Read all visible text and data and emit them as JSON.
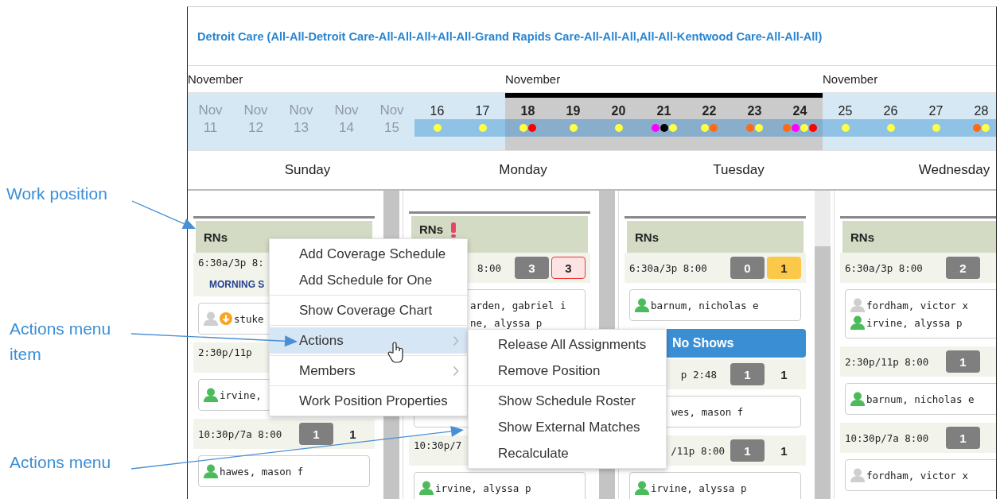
{
  "annotations": [
    {
      "text": "Work position"
    },
    {
      "text": "Actions menu item"
    },
    {
      "text": "Actions menu"
    }
  ],
  "title": "Detroit Care (All-All-Detroit Care-All-All-All+All-All-Grand Rapids Care-All-All-All,All-All-Kentwood Care-All-All-All)",
  "weeks": [
    {
      "month": "November",
      "selected": false,
      "dates": [
        {
          "label": "Nov",
          "day": "11",
          "dimmed": true
        },
        {
          "label": "Nov",
          "day": "12",
          "dimmed": true
        },
        {
          "label": "Nov",
          "day": "13",
          "dimmed": true
        },
        {
          "label": "Nov",
          "day": "14",
          "dimmed": true
        },
        {
          "label": "Nov",
          "day": "15",
          "dimmed": true
        },
        {
          "day": "16",
          "dimmed": false,
          "dots": [
            {
              "color": "#ffff44"
            }
          ]
        },
        {
          "day": "17",
          "dimmed": false,
          "dots": [
            {
              "color": "#ffff44"
            }
          ]
        }
      ]
    },
    {
      "month": "November",
      "selected": true,
      "dates": [
        {
          "day": "18",
          "dimmed": false,
          "dots": [
            {
              "color": "#ffff44"
            },
            {
              "color": "#ff0000"
            }
          ]
        },
        {
          "day": "19",
          "dimmed": false,
          "dots": [
            {
              "color": "#ffff44"
            }
          ]
        },
        {
          "day": "20",
          "dimmed": false,
          "dots": [
            {
              "color": "#ffff44"
            }
          ]
        },
        {
          "day": "21",
          "dimmed": false,
          "dots": [
            {
              "color": "#ff00ff"
            },
            {
              "color": "#000000"
            },
            {
              "color": "#ffff44"
            }
          ]
        },
        {
          "day": "22",
          "dimmed": false,
          "dots": [
            {
              "color": "#ffff44"
            },
            {
              "color": "#ff6a13"
            }
          ]
        },
        {
          "day": "23",
          "dimmed": false,
          "dots": [
            {
              "color": "#ff6a13"
            },
            {
              "color": "#ffff44"
            }
          ]
        },
        {
          "day": "24",
          "dimmed": false,
          "dots": [
            {
              "color": "#ff6a13"
            },
            {
              "color": "#ff00ff"
            },
            {
              "color": "#ffff44"
            },
            {
              "color": "#ff0000"
            }
          ]
        }
      ]
    },
    {
      "month": "November",
      "selected": false,
      "dates": [
        {
          "day": "25",
          "dimmed": false,
          "dots": [
            {
              "color": "#ffff44"
            }
          ]
        },
        {
          "day": "26",
          "dimmed": false,
          "dots": [
            {
              "color": "#ffff44"
            }
          ]
        },
        {
          "day": "27",
          "dimmed": false,
          "dots": [
            {
              "color": "#ffff44"
            }
          ]
        },
        {
          "day": "28",
          "dimmed": false,
          "dots": [
            {
              "color": "#ff6a13"
            },
            {
              "color": "#ffff44"
            }
          ]
        }
      ]
    }
  ],
  "days": [
    {
      "name": "Sunday",
      "position": {
        "title": "RNs",
        "alert": false
      },
      "blocks": [
        {
          "kind": "shift",
          "time": "6:30a/3p 8:",
          "label": "MORNING S"
        },
        {
          "kind": "card",
          "people": [
            {
              "name": "stuke",
              "confirmed": false,
              "flag": true
            }
          ]
        },
        {
          "kind": "shift",
          "time": "2:30p/11p"
        },
        {
          "kind": "card",
          "people": [
            {
              "name": "irvine,",
              "confirmed": true,
              "flag": false
            }
          ]
        },
        {
          "kind": "shift",
          "time": "10:30p/7a 8:00",
          "counts": [
            {
              "value": "1",
              "kind": "filled"
            },
            {
              "value": "1",
              "kind": "plain"
            }
          ]
        },
        {
          "kind": "card",
          "people": [
            {
              "name": "hawes, mason f",
              "confirmed": true,
              "flag": false
            }
          ]
        }
      ]
    },
    {
      "name": "Monday",
      "position": {
        "title": "RNs",
        "alert": true
      },
      "blocks": [
        {
          "kind": "shift",
          "time": "8:00",
          "counts": [
            {
              "value": "3",
              "kind": "filled"
            },
            {
              "value": "3",
              "kind": "short"
            }
          ]
        },
        {
          "kind": "card",
          "people": [
            {
              "name": "arden, gabriel i"
            },
            {
              "name": "ne, alyssa p"
            }
          ]
        },
        {
          "kind": "shift"
        },
        {
          "kind": "card"
        },
        {
          "kind": "shift",
          "time": "10:30p/7"
        },
        {
          "kind": "card",
          "people": [
            {
              "name": "irvine, alyssa p",
              "confirmed": true,
              "flag": false
            }
          ]
        }
      ]
    },
    {
      "name": "Tuesday",
      "position": {
        "title": "RNs",
        "alert": false
      },
      "blocks": [
        {
          "kind": "shift",
          "time": "6:30a/3p 8:00",
          "counts": [
            {
              "value": "0",
              "kind": "filled"
            },
            {
              "value": "1",
              "kind": "warning"
            }
          ]
        },
        {
          "kind": "card",
          "people": [
            {
              "name": "barnum, nicholas e",
              "confirmed": true,
              "flag": false
            }
          ]
        },
        {
          "kind": "banner",
          "text": "No Shows"
        },
        {
          "kind": "shift",
          "time": "p 2:48",
          "counts": [
            {
              "value": "1",
              "kind": "filled"
            },
            {
              "value": "1",
              "kind": "plain"
            }
          ]
        },
        {
          "kind": "card",
          "people": [
            {
              "name": "wes, mason f"
            }
          ]
        },
        {
          "kind": "shift",
          "time": "/11p 8:00",
          "counts": [
            {
              "value": "1",
              "kind": "filled"
            },
            {
              "value": "1",
              "kind": "plain"
            }
          ]
        },
        {
          "kind": "card",
          "people": [
            {
              "name": "irvine, alyssa p",
              "confirmed": true,
              "flag": false
            }
          ]
        }
      ]
    },
    {
      "name": "Wednesday",
      "position": {
        "title": "RNs",
        "alert": false
      },
      "blocks": [
        {
          "kind": "shift",
          "time": "6:30a/3p 8:00",
          "counts": [
            {
              "value": "2",
              "kind": "filled"
            }
          ]
        },
        {
          "kind": "card",
          "people": [
            {
              "name": "fordham, victor x",
              "confirmed": false,
              "flag": false
            },
            {
              "name": "irvine, alyssa p",
              "confirmed": true,
              "flag": false
            }
          ]
        },
        {
          "kind": "shift",
          "time": "2:30p/11p 8:00",
          "counts": [
            {
              "value": "1",
              "kind": "filled"
            }
          ]
        },
        {
          "kind": "card",
          "people": [
            {
              "name": "barnum, nicholas e",
              "confirmed": true,
              "flag": false
            }
          ]
        },
        {
          "kind": "shift",
          "time": "10:30p/7a 8:00",
          "counts": [
            {
              "value": "1",
              "kind": "filled"
            }
          ]
        },
        {
          "kind": "card",
          "people": [
            {
              "name": "fordham, victor x",
              "confirmed": false,
              "flag": false
            }
          ]
        }
      ]
    }
  ],
  "context_menu": {
    "sections": [
      [
        {
          "label": "Add Coverage Schedule",
          "selected": false,
          "submenu": false
        },
        {
          "label": "Add Schedule for One",
          "selected": false,
          "submenu": false
        }
      ],
      [
        {
          "label": "Show Coverage Chart",
          "selected": false,
          "submenu": false
        }
      ],
      [
        {
          "label": "Actions",
          "selected": true,
          "submenu": true
        }
      ],
      [
        {
          "label": "Members",
          "selected": false,
          "submenu": true
        }
      ],
      [
        {
          "label": "Work Position Properties",
          "selected": false,
          "submenu": false
        }
      ]
    ]
  },
  "actions_menu": {
    "sections": [
      [
        {
          "label": "Release All Assignments",
          "selected": false,
          "submenu": false
        },
        {
          "label": "Remove Position",
          "selected": false,
          "submenu": false
        }
      ],
      [
        {
          "label": "Show Schedule Roster",
          "selected": false,
          "submenu": false
        },
        {
          "label": "Show External Matches",
          "selected": false,
          "submenu": false
        },
        {
          "label": "Recalculate",
          "selected": false,
          "submenu": false
        }
      ]
    ]
  }
}
